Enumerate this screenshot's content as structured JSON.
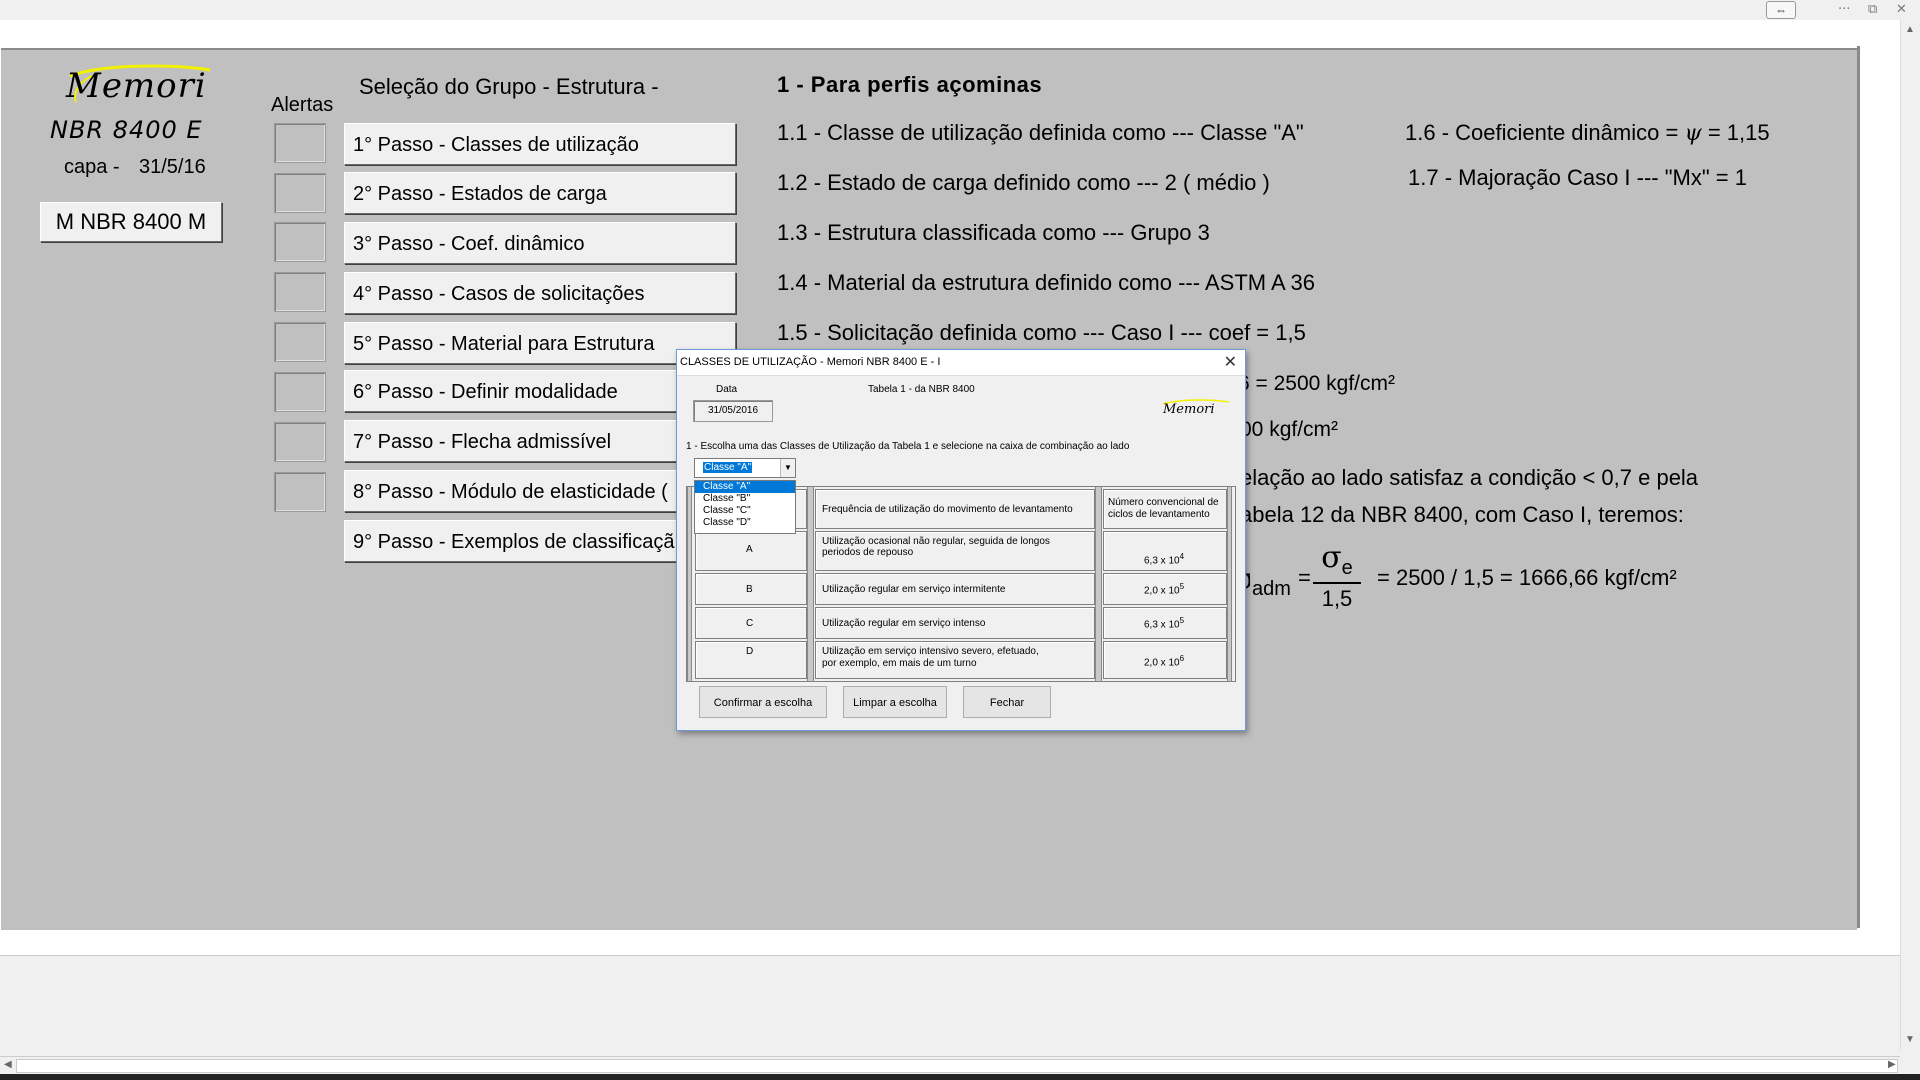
{
  "window_controls": {
    "resize": "⇔",
    "more": "···",
    "restore": "⧉",
    "close": "✕"
  },
  "logo": {
    "text": "Memori"
  },
  "header": {
    "nbr_title": "NBR 8400 E",
    "capa_label": "capa -",
    "capa_date": "31/5/16",
    "m_button": "M NBR 8400 M"
  },
  "alerts": {
    "label": "Alertas"
  },
  "group": {
    "title": "Seleção do Grupo - Estrutura -"
  },
  "steps": [
    "1° Passo - Classes de utilização",
    "2° Passo - Estados de carga",
    "3° Passo - Coef. dinâmico",
    "4° Passo - Casos de solicitações",
    "5° Passo - Material para Estrutura",
    "6° Passo - Definir modalidade",
    "7° Passo - Flecha admissível",
    "8° Passo - Módulo de elasticidade (",
    "9° Passo - Exemplos de classificaçã"
  ],
  "summary": {
    "title": "1 - Para perfis açominas",
    "l1_1": "1.1 - Classe de utilização definida como --- Classe \"A\"",
    "l1_2": "1.2 - Estado de carga definido como --- 2 ( médio )",
    "l1_3": "1.3 - Estrutura classificada como --- Grupo 3",
    "l1_4": "1.4 - Material da estrutura definido como --- ASTM A 36",
    "l1_5": "1.5 - Solicitação definida como --- Caso I --- coef =  1,5",
    "l1_6_pre": "1.6 - Coeficiente dinâmico = ",
    "l1_6_psi": "ψ",
    "l1_6_val": " = 1,15",
    "l1_7": "1.7 - Majoração Caso I --- \"Mx\" = 1",
    "frag1": "6 = 2500 kgf/cm²",
    "frag2": "00 kgf/cm²",
    "frag3": "elação ao lado satisfaz a condição < 0,7 e pela",
    "frag4": "abela 12 da NBR 8400, com Caso I, teremos:",
    "sigma_adm": "σ",
    "sigma_adm_sub": "adm",
    "eq": "=",
    "sigma_e": "σ",
    "sigma_e_sub": "e",
    "den": "1,5",
    "result": "= 2500 / 1,5 = 1666,66 kgf/cm²"
  },
  "dialog": {
    "title": "CLASSES DE UTILIZAÇÃO - Memori NBR 8400 E - I",
    "close": "✕",
    "data_label": "Data",
    "data_value": "31/05/2016",
    "tabela_label": "Tabela 1 -  da  NBR 8400",
    "logo": "Memori",
    "instruction": "1 - Escolha uma das Classes de Utilização da Tabela 1 e selecione na caixa de combinação ao lado",
    "combo_value": "Classe \"A\"",
    "options": [
      "Classe \"A\"",
      "Classe \"B\"",
      "Classe \"C\"",
      "Classe \"D\""
    ],
    "table": {
      "header_freq": "Frequência de utilização do movimento de levantamento",
      "header_num_1": "Número convencional de",
      "header_num_2": "ciclos de levantamento",
      "rows": [
        {
          "cls": "A",
          "desc1": "Utilização ocasional não regular, seguida de longos",
          "desc2": "periodos de repouso",
          "num": "6,3 x 10",
          "exp": "4"
        },
        {
          "cls": "B",
          "desc1": "Utilização regular em serviço intermitente",
          "desc2": "",
          "num": "2,0 x 10",
          "exp": "5"
        },
        {
          "cls": "C",
          "desc1": "Utilização regular em serviço intenso",
          "desc2": "",
          "num": "6,3 x 10",
          "exp": "5"
        },
        {
          "cls": "D",
          "desc1": "Utilização em serviço intensivo severo, efetuado,",
          "desc2": "por exemplo, em mais de um turno",
          "num": "2,0 x 10",
          "exp": "6"
        }
      ]
    },
    "buttons": {
      "confirm": "Confirmar a escolha",
      "clear": "Limpar a escolha",
      "close": "Fechar"
    }
  }
}
